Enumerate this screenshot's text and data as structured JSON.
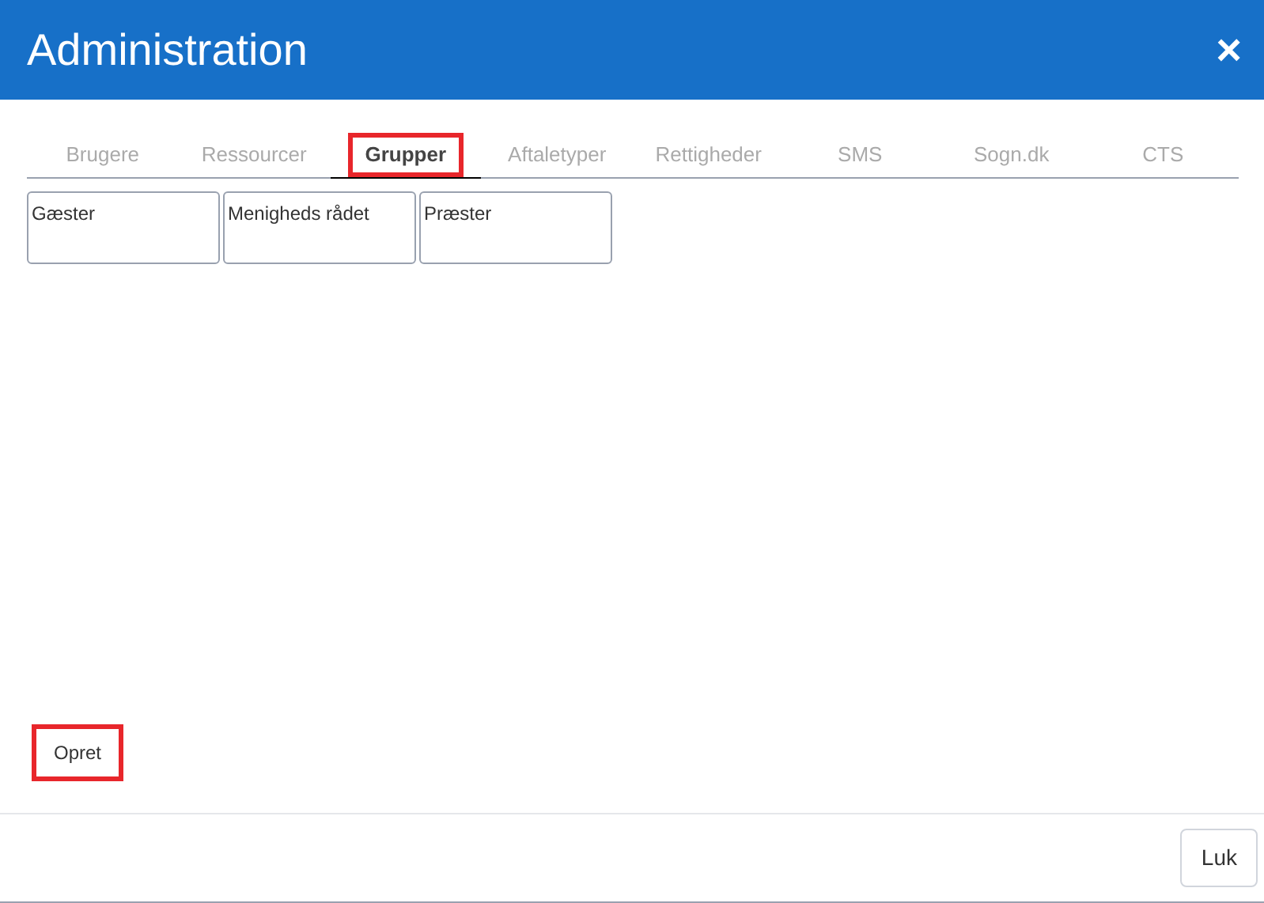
{
  "window": {
    "title": "Administration",
    "close": "×"
  },
  "tabs": [
    {
      "label": "Brugere",
      "selected": false,
      "highlighted": false
    },
    {
      "label": "Ressourcer",
      "selected": false,
      "highlighted": false
    },
    {
      "label": "Grupper",
      "selected": true,
      "highlighted": true
    },
    {
      "label": "Aftaletyper",
      "selected": false,
      "highlighted": false
    },
    {
      "label": "Rettigheder",
      "selected": false,
      "highlighted": false
    },
    {
      "label": "SMS",
      "selected": false,
      "highlighted": false
    },
    {
      "label": "Sogn.dk",
      "selected": false,
      "highlighted": false
    },
    {
      "label": "CTS",
      "selected": false,
      "highlighted": false
    }
  ],
  "groups": [
    "Gæster",
    "Menigheds rådet",
    "Præster"
  ],
  "create_button": {
    "label": "Opret",
    "highlighted": true
  },
  "footer": {
    "close_button": "Luk"
  }
}
